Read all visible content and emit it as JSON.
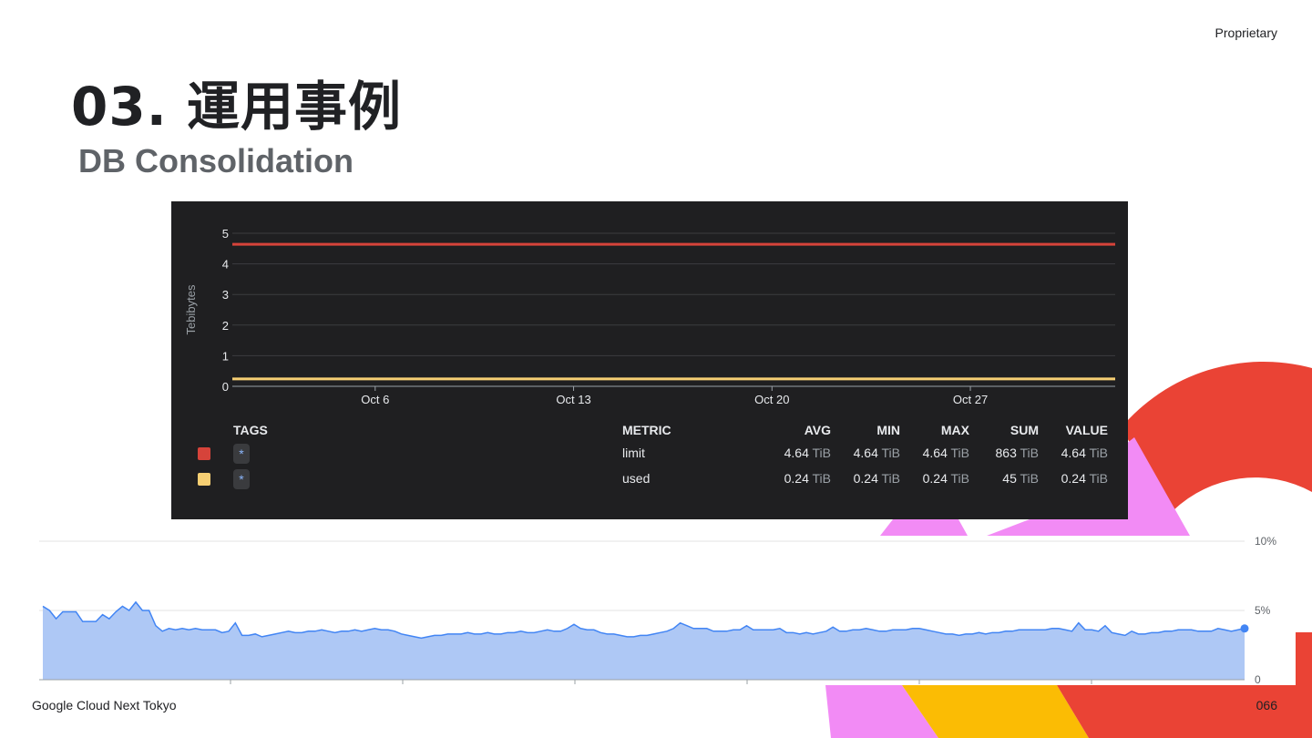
{
  "slide": {
    "proprietary": "Proprietary",
    "title": "03. 運用事例",
    "subtitle": "DB Consolidation",
    "footer_left": "Google Cloud Next Tokyo",
    "page_number": "066"
  },
  "colors": {
    "limit": "#d6433a",
    "used": "#f6cf73",
    "area_fill": "#aec8f5",
    "area_line": "#4285f4",
    "deco_red": "#ea4335",
    "deco_pink": "#f28bf5",
    "deco_yellow": "#fbbc04"
  },
  "chart_data": [
    {
      "type": "line",
      "ylabel": "Tebibytes",
      "yticks": [
        "0",
        "1",
        "2",
        "3",
        "4",
        "5"
      ],
      "ylim": [
        0,
        5
      ],
      "xticks": [
        "Oct 6",
        "Oct 13",
        "Oct 20",
        "Oct 27"
      ],
      "grid": true,
      "series": [
        {
          "name": "limit",
          "values": [
            4.64,
            4.64
          ]
        },
        {
          "name": "used",
          "values": [
            0.24,
            0.24
          ]
        }
      ],
      "legend": {
        "columns": {
          "tags": "TAGS",
          "metric": "METRIC",
          "avg": "AVG",
          "min": "MIN",
          "max": "MAX",
          "sum": "SUM",
          "value": "VALUE"
        },
        "rows": [
          {
            "tag": "*",
            "metric": "limit",
            "avg": "4.64",
            "min": "4.64",
            "max": "4.64",
            "sum": "863",
            "value": "4.64",
            "avg_unit": "TiB",
            "min_unit": "TiB",
            "max_unit": "TiB",
            "sum_unit": "TiB",
            "value_unit": "TiB"
          },
          {
            "tag": "*",
            "metric": "used",
            "avg": "0.24",
            "min": "0.24",
            "max": "0.24",
            "sum": "45",
            "value": "0.24",
            "avg_unit": "TiB",
            "min_unit": "TiB",
            "max_unit": "TiB",
            "sum_unit": "TiB",
            "value_unit": "TiB"
          }
        ]
      }
    },
    {
      "type": "area",
      "yticks": [
        "0",
        "5%",
        "10%"
      ],
      "ylim": [
        0,
        10
      ],
      "grid": true,
      "values": [
        5.3,
        5.0,
        4.4,
        4.9,
        4.9,
        4.9,
        4.2,
        4.2,
        4.2,
        4.7,
        4.4,
        4.9,
        5.3,
        5.0,
        5.6,
        5.0,
        5.0,
        3.9,
        3.5,
        3.7,
        3.6,
        3.7,
        3.6,
        3.7,
        3.6,
        3.6,
        3.6,
        3.4,
        3.5,
        4.1,
        3.2,
        3.2,
        3.3,
        3.1,
        3.2,
        3.3,
        3.4,
        3.5,
        3.4,
        3.4,
        3.5,
        3.5,
        3.6,
        3.5,
        3.4,
        3.5,
        3.5,
        3.6,
        3.5,
        3.6,
        3.7,
        3.6,
        3.6,
        3.5,
        3.3,
        3.2,
        3.1,
        3.0,
        3.1,
        3.2,
        3.2,
        3.3,
        3.3,
        3.3,
        3.4,
        3.3,
        3.3,
        3.4,
        3.3,
        3.3,
        3.4,
        3.4,
        3.5,
        3.4,
        3.4,
        3.5,
        3.6,
        3.5,
        3.5,
        3.7,
        4.0,
        3.7,
        3.6,
        3.6,
        3.4,
        3.3,
        3.3,
        3.2,
        3.1,
        3.1,
        3.2,
        3.2,
        3.3,
        3.4,
        3.5,
        3.7,
        4.1,
        3.9,
        3.7,
        3.7,
        3.7,
        3.5,
        3.5,
        3.5,
        3.6,
        3.6,
        3.9,
        3.6,
        3.6,
        3.6,
        3.6,
        3.7,
        3.4,
        3.4,
        3.3,
        3.4,
        3.3,
        3.4,
        3.5,
        3.8,
        3.5,
        3.5,
        3.6,
        3.6,
        3.7,
        3.6,
        3.5,
        3.5,
        3.6,
        3.6,
        3.6,
        3.7,
        3.7,
        3.6,
        3.5,
        3.4,
        3.3,
        3.3,
        3.2,
        3.3,
        3.3,
        3.4,
        3.3,
        3.4,
        3.4,
        3.5,
        3.5,
        3.6,
        3.6,
        3.6,
        3.6,
        3.6,
        3.7,
        3.7,
        3.6,
        3.5,
        4.1,
        3.6,
        3.6,
        3.5,
        3.9,
        3.4,
        3.3,
        3.2,
        3.5,
        3.3,
        3.3,
        3.4,
        3.4,
        3.5,
        3.5,
        3.6,
        3.6,
        3.6,
        3.5,
        3.5,
        3.5,
        3.7,
        3.6,
        3.5,
        3.6,
        3.7
      ]
    }
  ]
}
